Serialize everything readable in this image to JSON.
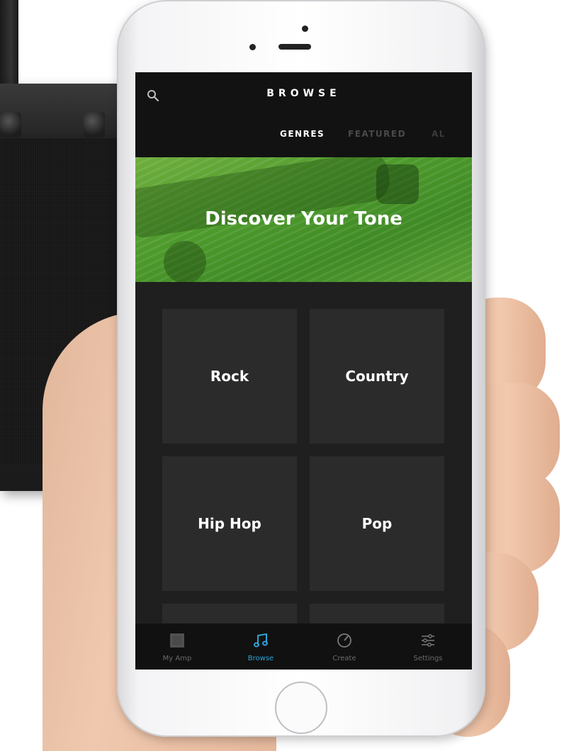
{
  "header": {
    "title": "BROWSE",
    "search_icon": "search-icon"
  },
  "tabs": [
    {
      "label": "GENRES",
      "active": true
    },
    {
      "label": "FEATURED",
      "active": false
    },
    {
      "label": "AL",
      "active": false
    }
  ],
  "banner": {
    "title": "Discover Your Tone",
    "color": "#4d9a2c"
  },
  "genres": [
    {
      "label": "Rock"
    },
    {
      "label": "Country"
    },
    {
      "label": "Hip Hop"
    },
    {
      "label": "Pop"
    }
  ],
  "bottom_nav": [
    {
      "label": "My Amp",
      "icon": "amp-icon",
      "active": false
    },
    {
      "label": "Browse",
      "icon": "music-note-icon",
      "active": true
    },
    {
      "label": "Create",
      "icon": "dial-icon",
      "active": false
    },
    {
      "label": "Settings",
      "icon": "sliders-icon",
      "active": false
    }
  ],
  "colors": {
    "accent": "#2ea3d6",
    "background": "#1f1f1f",
    "card": "#2b2b2b"
  }
}
